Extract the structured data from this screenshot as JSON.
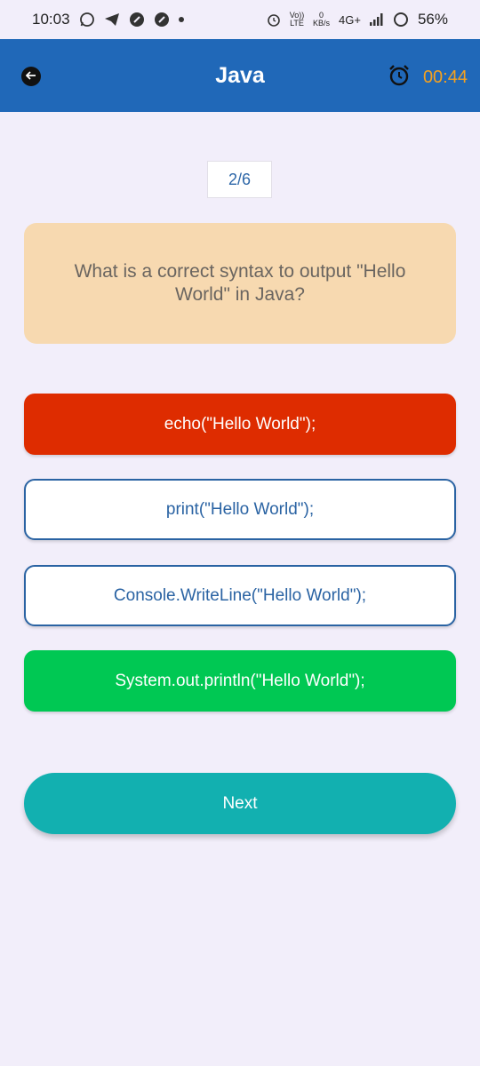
{
  "status_bar": {
    "time": "10:03",
    "network_speed_value": "0",
    "network_speed_unit": "KB/s",
    "volte_label": "Vo)) LTE",
    "network_type": "4G+",
    "battery": "56%"
  },
  "app_bar": {
    "title": "Java",
    "timer": "00:44"
  },
  "quiz": {
    "counter": "2/6",
    "question": "What is a correct syntax to output \"Hello World\" in Java?",
    "options": [
      {
        "label": "echo(\"Hello World\");",
        "state": "wrong"
      },
      {
        "label": "print(\"Hello World\");",
        "state": "neutral"
      },
      {
        "label": "Console.WriteLine(\"Hello World\");",
        "state": "neutral"
      },
      {
        "label": "System.out.println(\"Hello World\");",
        "state": "correct"
      }
    ],
    "next_label": "Next"
  },
  "colors": {
    "app_bar": "#2068b8",
    "timer": "#f4a11f",
    "wrong": "#de2c00",
    "correct": "#00c853",
    "next": "#12b0b0",
    "question_card": "#f7d9b0"
  }
}
